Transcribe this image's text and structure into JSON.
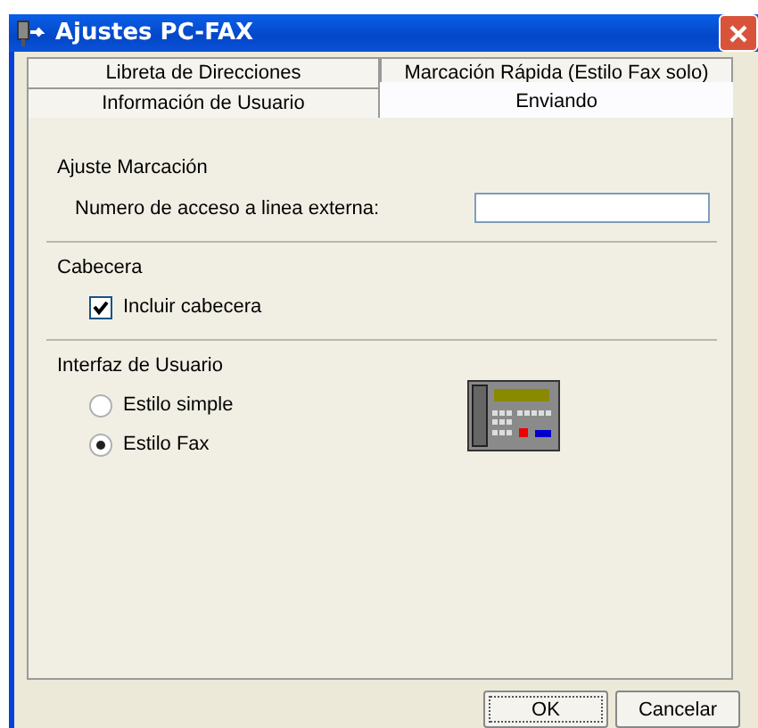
{
  "window": {
    "title": "Ajustes PC-FAX"
  },
  "tab_rows": [
    [
      {
        "label": "Libreta de Direcciones",
        "selected": false
      },
      {
        "label": "Marcación Rápida (Estilo Fax solo)",
        "selected": false
      }
    ],
    [
      {
        "label": "Información de Usuario",
        "selected": false
      },
      {
        "label": "Enviando",
        "selected": true
      }
    ]
  ],
  "sections": [
    {
      "kind": "field",
      "title": "Ajuste Marcación",
      "label": "Numero de acceso a linea externa:"
    },
    {
      "kind": "checkbox",
      "title": "Cabecera",
      "label": "Incluir cabecera",
      "checked": true
    },
    {
      "kind": "radios",
      "title": "Interfaz de Usuario",
      "options": [
        {
          "label": "Estilo simple",
          "selected": false
        },
        {
          "label": "Estilo Fax",
          "selected": true
        }
      ]
    }
  ],
  "buttons": [
    {
      "label": "OK",
      "default": true
    },
    {
      "label": "Cancelar",
      "default": false
    }
  ]
}
